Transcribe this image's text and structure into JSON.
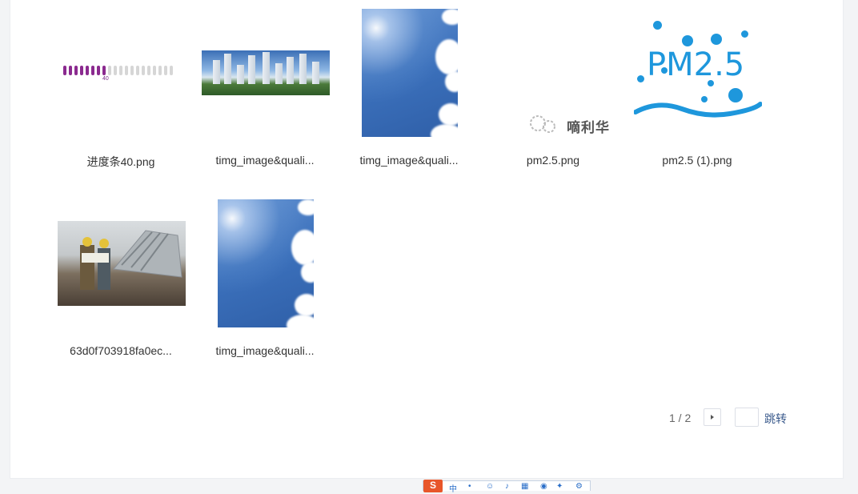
{
  "files": [
    {
      "name": "进度条40.png",
      "kind": "progress-bar-image",
      "progress_value": "40",
      "progress_fraction": 0.4
    },
    {
      "name": "timg_image&quali...",
      "kind": "buildings-photo"
    },
    {
      "name": "timg_image&quali...",
      "kind": "sky-photo"
    },
    {
      "name": "pm2.5.png",
      "kind": "watermark-image",
      "watermark_text": "嘀利华"
    },
    {
      "name": "pm2.5 (1).png",
      "kind": "pm-logo-image",
      "logo_text": "PM2.5"
    },
    {
      "name": "63d0f703918fa0ec...",
      "kind": "workers-photo"
    },
    {
      "name": "timg_image&quali...",
      "kind": "sky-photo"
    }
  ],
  "pagination": {
    "current": "1",
    "separator": "/",
    "total": "2",
    "display": "1 / 2",
    "jump_value": "",
    "jump_label": "跳转"
  },
  "taskbar": {
    "ime_logo": "S",
    "ime_mode": "中"
  },
  "colors": {
    "accent_purple": "#8b2a8f",
    "pm_blue": "#1e97dc",
    "link_blue": "#3a5a8c"
  }
}
